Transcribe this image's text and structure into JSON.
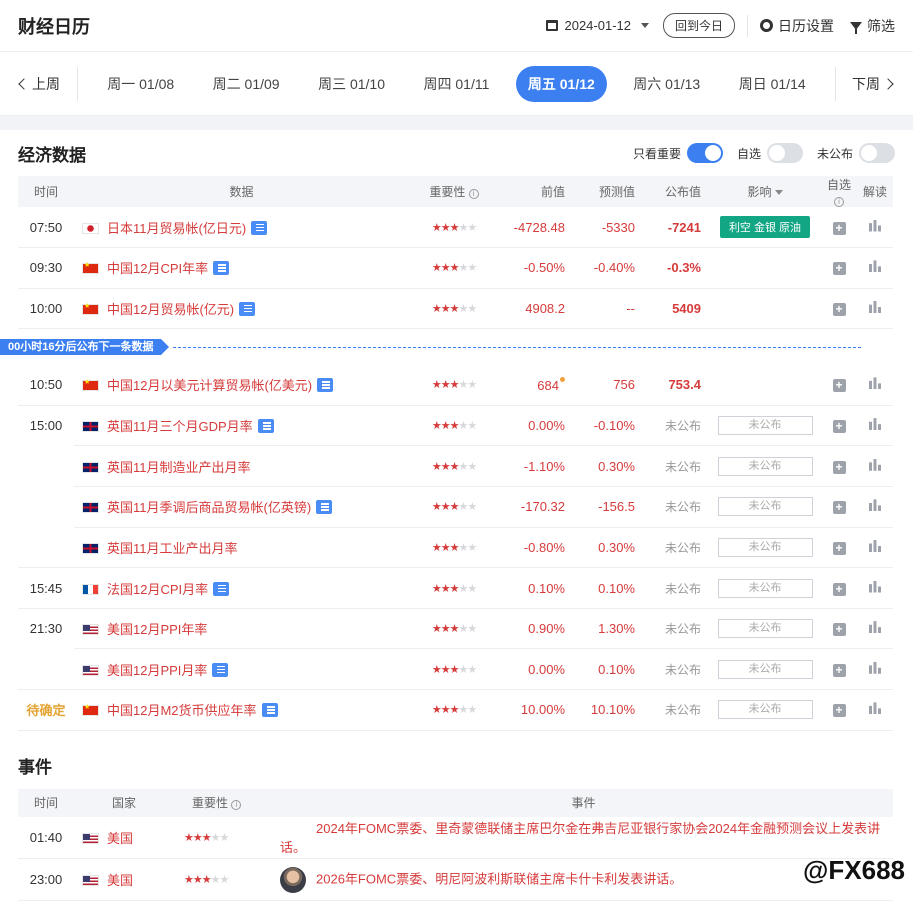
{
  "header": {
    "title": "财经日历",
    "date": "2024-01-12",
    "today_btn": "回到今日",
    "settings": "日历设置",
    "filter": "筛选"
  },
  "weeknav": {
    "prev": "上周",
    "next": "下周",
    "days": [
      "周一 01/08",
      "周二 01/09",
      "周三 01/10",
      "周四 01/11",
      "周五 01/12",
      "周六 01/13",
      "周日 01/14"
    ],
    "active_index": 4
  },
  "econ": {
    "title": "经济数据",
    "toggles": [
      {
        "label": "只看重要",
        "on": true
      },
      {
        "label": "自选",
        "on": false
      },
      {
        "label": "未公布",
        "on": false
      }
    ],
    "columns": {
      "time": "时间",
      "data": "数据",
      "importance": "重要性",
      "prev": "前值",
      "forecast": "预测值",
      "actual": "公布值",
      "impact": "影响",
      "fav": "自选",
      "detail": "解读"
    },
    "countdown": "00小时16分后公布下一条数据",
    "rows": [
      {
        "time": "07:50",
        "flag": "jp",
        "name": "日本11月贸易帐(亿日元)",
        "stars": 3,
        "prev": "-4728.48",
        "forecast": "-5330",
        "actual": "-7241",
        "impact": "利空 金银 原油"
      },
      {
        "time": "09:30",
        "flag": "cn",
        "name": "中国12月CPI年率",
        "stars": 3,
        "prev": "-0.50%",
        "forecast": "-0.40%",
        "actual": "-0.3%",
        "impact": ""
      },
      {
        "time": "10:00",
        "flag": "cn",
        "name": "中国12月贸易帐(亿元)",
        "stars": 3,
        "prev": "4908.2",
        "forecast": "--",
        "actual": "5409",
        "impact": ""
      },
      {
        "time": "10:50",
        "flag": "cn",
        "name": "中国12月以美元计算贸易帐(亿美元)",
        "stars": 3,
        "prev": "684",
        "forecast": "756",
        "actual": "753.4",
        "impact": "",
        "dot": true
      },
      {
        "time": "15:00",
        "flag": "uk",
        "name": "英国11月三个月GDP月率",
        "stars": 3,
        "prev": "0.00%",
        "forecast": "-0.10%",
        "actual": "未公布",
        "impact": "未公布"
      },
      {
        "time": "",
        "flag": "uk",
        "name": "英国11月制造业产出月率",
        "stars": 3,
        "prev": "-1.10%",
        "forecast": "0.30%",
        "actual": "未公布",
        "impact": "未公布",
        "noicon": true
      },
      {
        "time": "",
        "flag": "uk",
        "name": "英国11月季调后商品贸易帐(亿英镑)",
        "stars": 3,
        "prev": "-170.32",
        "forecast": "-156.5",
        "actual": "未公布",
        "impact": "未公布"
      },
      {
        "time": "",
        "flag": "uk",
        "name": "英国11月工业产出月率",
        "stars": 3,
        "prev": "-0.80%",
        "forecast": "0.30%",
        "actual": "未公布",
        "impact": "未公布",
        "noicon": true
      },
      {
        "time": "15:45",
        "flag": "fr",
        "name": "法国12月CPI月率",
        "stars": 3,
        "prev": "0.10%",
        "forecast": "0.10%",
        "actual": "未公布",
        "impact": "未公布"
      },
      {
        "time": "21:30",
        "flag": "us",
        "name": "美国12月PPI年率",
        "stars": 3,
        "prev": "0.90%",
        "forecast": "1.30%",
        "actual": "未公布",
        "impact": "未公布",
        "noicon": true
      },
      {
        "time": "",
        "flag": "us",
        "name": "美国12月PPI月率",
        "stars": 3,
        "prev": "0.00%",
        "forecast": "0.10%",
        "actual": "未公布",
        "impact": "未公布"
      },
      {
        "time": "待确定",
        "flag": "cn",
        "name": "中国12月M2货币供应年率",
        "stars": 3,
        "prev": "10.00%",
        "forecast": "10.10%",
        "actual": "未公布",
        "impact": "未公布",
        "pending": true
      }
    ]
  },
  "events": {
    "title": "事件",
    "columns": {
      "time": "时间",
      "country": "国家",
      "importance": "重要性",
      "event": "事件"
    },
    "rows": [
      {
        "time": "01:40",
        "flag": "us",
        "country": "美国",
        "stars": 3,
        "text": "2024年FOMC票委、里奇蒙德联储主席巴尔金在弗吉尼亚银行家协会2024年金融预测会议上发表讲话。",
        "avatar": false
      },
      {
        "time": "23:00",
        "flag": "us",
        "country": "美国",
        "stars": 3,
        "text": "2026年FOMC票委、明尼阿波利斯联储主席卡什卡利发表讲话。",
        "avatar": true
      }
    ]
  },
  "watermark": "@FX688"
}
